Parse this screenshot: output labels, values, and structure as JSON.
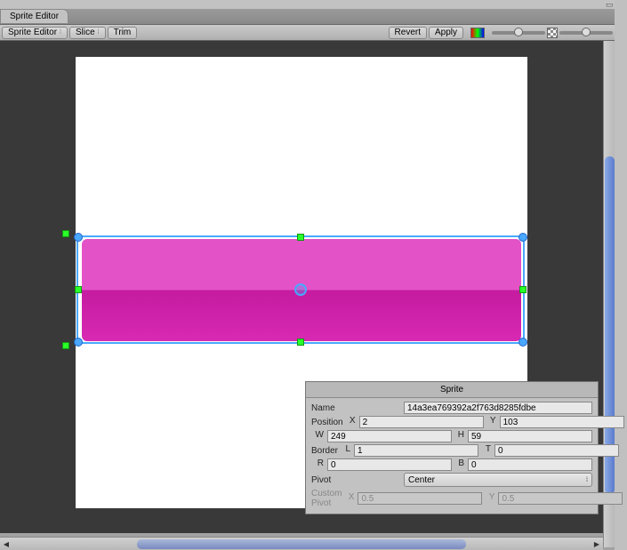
{
  "window": {
    "tab_title": "Sprite Editor"
  },
  "toolbar": {
    "mode": "Sprite Editor",
    "slice": "Slice",
    "trim": "Trim",
    "revert": "Revert",
    "apply": "Apply"
  },
  "inspector": {
    "title": "Sprite",
    "name_label": "Name",
    "name_value": "14a3ea769392a2f763d8285fdbe",
    "position_label": "Position",
    "pos_x_label": "X",
    "pos_x": "2",
    "pos_y_label": "Y",
    "pos_y": "103",
    "pos_w_label": "W",
    "pos_w": "249",
    "pos_h_label": "H",
    "pos_h": "59",
    "border_label": "Border",
    "border_l_label": "L",
    "border_l": "1",
    "border_t_label": "T",
    "border_t": "0",
    "border_r_label": "R",
    "border_r": "0",
    "border_b_label": "B",
    "border_b": "0",
    "pivot_label": "Pivot",
    "pivot_value": "Center",
    "custom_pivot_label": "Custom Pivot",
    "custom_x_label": "X",
    "custom_x": "0.5",
    "custom_y_label": "Y",
    "custom_y": "0.5"
  }
}
